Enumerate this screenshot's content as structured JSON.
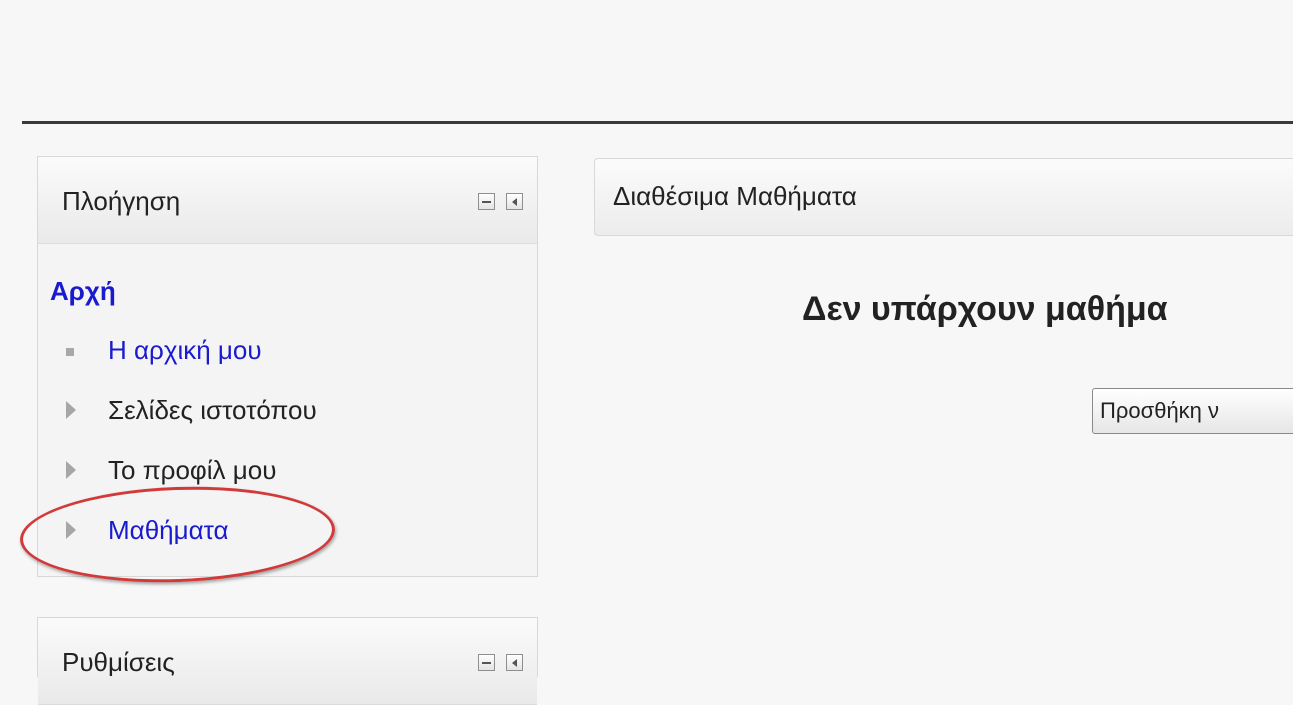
{
  "navigation": {
    "title": "Πλοήγηση",
    "home": "Αρχή",
    "items": [
      {
        "label": "Η αρχική μου",
        "marker": "square-bullet-icon",
        "style": "link"
      },
      {
        "label": "Σελίδες ιστοτόπου",
        "marker": "expand-arrow-icon",
        "style": "plain"
      },
      {
        "label": "Το προφίλ μου",
        "marker": "expand-arrow-icon",
        "style": "plain"
      },
      {
        "label": "Μαθήματα",
        "marker": "expand-arrow-icon",
        "style": "link"
      }
    ]
  },
  "settings": {
    "title": "Ρυθμίσεις"
  },
  "main": {
    "panel_title": "Διαθέσιμα Μαθήματα",
    "empty_message": "Δεν υπάρχουν μαθήμα",
    "add_button_label": "Προσθήκη ν"
  },
  "colors": {
    "link": "#1a1acf",
    "highlight_oval": "#d23a3a"
  }
}
